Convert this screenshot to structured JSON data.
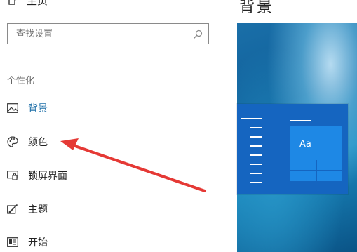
{
  "sidebar": {
    "home_label": "主页",
    "search_placeholder": "查找设置",
    "section_label": "个性化",
    "items": [
      {
        "label": "背景",
        "icon": "picture-icon",
        "active": true
      },
      {
        "label": "颜色",
        "icon": "palette-icon",
        "active": false
      },
      {
        "label": "锁屏界面",
        "icon": "lock-screen-icon",
        "active": false
      },
      {
        "label": "主题",
        "icon": "theme-brush-icon",
        "active": false
      },
      {
        "label": "开始",
        "icon": "start-menu-icon",
        "active": false
      }
    ]
  },
  "main": {
    "title": "背景",
    "preview_tile_text": "Aa"
  },
  "colors": {
    "accent": "#1e6fa8",
    "arrow": "#e53935"
  }
}
